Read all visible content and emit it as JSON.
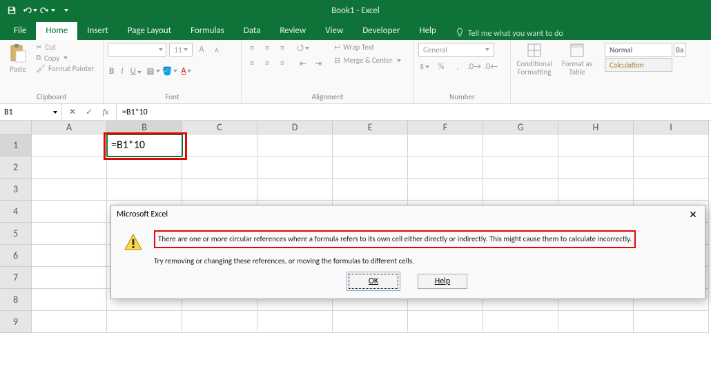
{
  "title": "Book1 - Excel",
  "qat": {
    "save": "save-icon",
    "undo": "undo-icon",
    "redo": "redo-icon"
  },
  "tabs": {
    "file": "File",
    "home": "Home",
    "insert": "Insert",
    "pagelayout": "Page Layout",
    "formulas": "Formulas",
    "data": "Data",
    "review": "Review",
    "view": "View",
    "developer": "Developer",
    "help": "Help",
    "tellme": "Tell me what you want to do"
  },
  "ribbon": {
    "clipboard": {
      "paste": "Paste",
      "cut": "Cut",
      "copy": "Copy",
      "fmt": "Format Painter",
      "label": "Clipboard"
    },
    "font": {
      "name": "",
      "size": "11",
      "btns": {
        "biggerA": "A",
        "smallerA": "A",
        "b": "B",
        "i": "I",
        "u": "U"
      },
      "label": "Font"
    },
    "alignment": {
      "wrap": "Wrap Text",
      "merge": "Merge & Center",
      "label": "Alignment"
    },
    "number": {
      "format": "General",
      "label": "Number"
    },
    "styles": {
      "cond": "Conditional Formatting",
      "table": "Format as Table",
      "normal": "Normal",
      "bad": "Ba",
      "calc": "Calculation"
    },
    "group_styles_label": ""
  },
  "fbar": {
    "name": "B1",
    "formula": "=B1*10"
  },
  "grid": {
    "cols": [
      "A",
      "B",
      "C",
      "D",
      "E",
      "F",
      "G",
      "H",
      "I"
    ],
    "rows": [
      "1",
      "2",
      "3",
      "4",
      "5",
      "6",
      "7",
      "8",
      "9"
    ],
    "active_cell_text": "=B1*10"
  },
  "dialog": {
    "title": "Microsoft Excel",
    "line1": "There are one or more circular references where a formula refers to its own cell either directly or indirectly. This might cause them to calculate incorrectly.",
    "line2": "Try removing or changing these references, or moving the formulas to different cells.",
    "ok": "OK",
    "help": "Help"
  }
}
